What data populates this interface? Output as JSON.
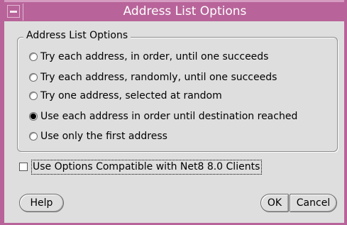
{
  "window": {
    "title": "Address List Options",
    "accent_color": "#b8649a"
  },
  "group": {
    "legend": "Address List Options",
    "options": [
      {
        "label": "Try each address, in order, until one succeeds",
        "selected": false
      },
      {
        "label": "Try each address, randomly, until one succeeds",
        "selected": false
      },
      {
        "label": "Try one address, selected at random",
        "selected": false
      },
      {
        "label": "Use each address in order until destination reached",
        "selected": true
      },
      {
        "label": "Use only the first address",
        "selected": false
      }
    ]
  },
  "compat_checkbox": {
    "label": "Use Options Compatible with Net8 8.0 Clients",
    "checked": false
  },
  "buttons": {
    "help": "Help",
    "ok": "OK",
    "cancel": "Cancel"
  }
}
